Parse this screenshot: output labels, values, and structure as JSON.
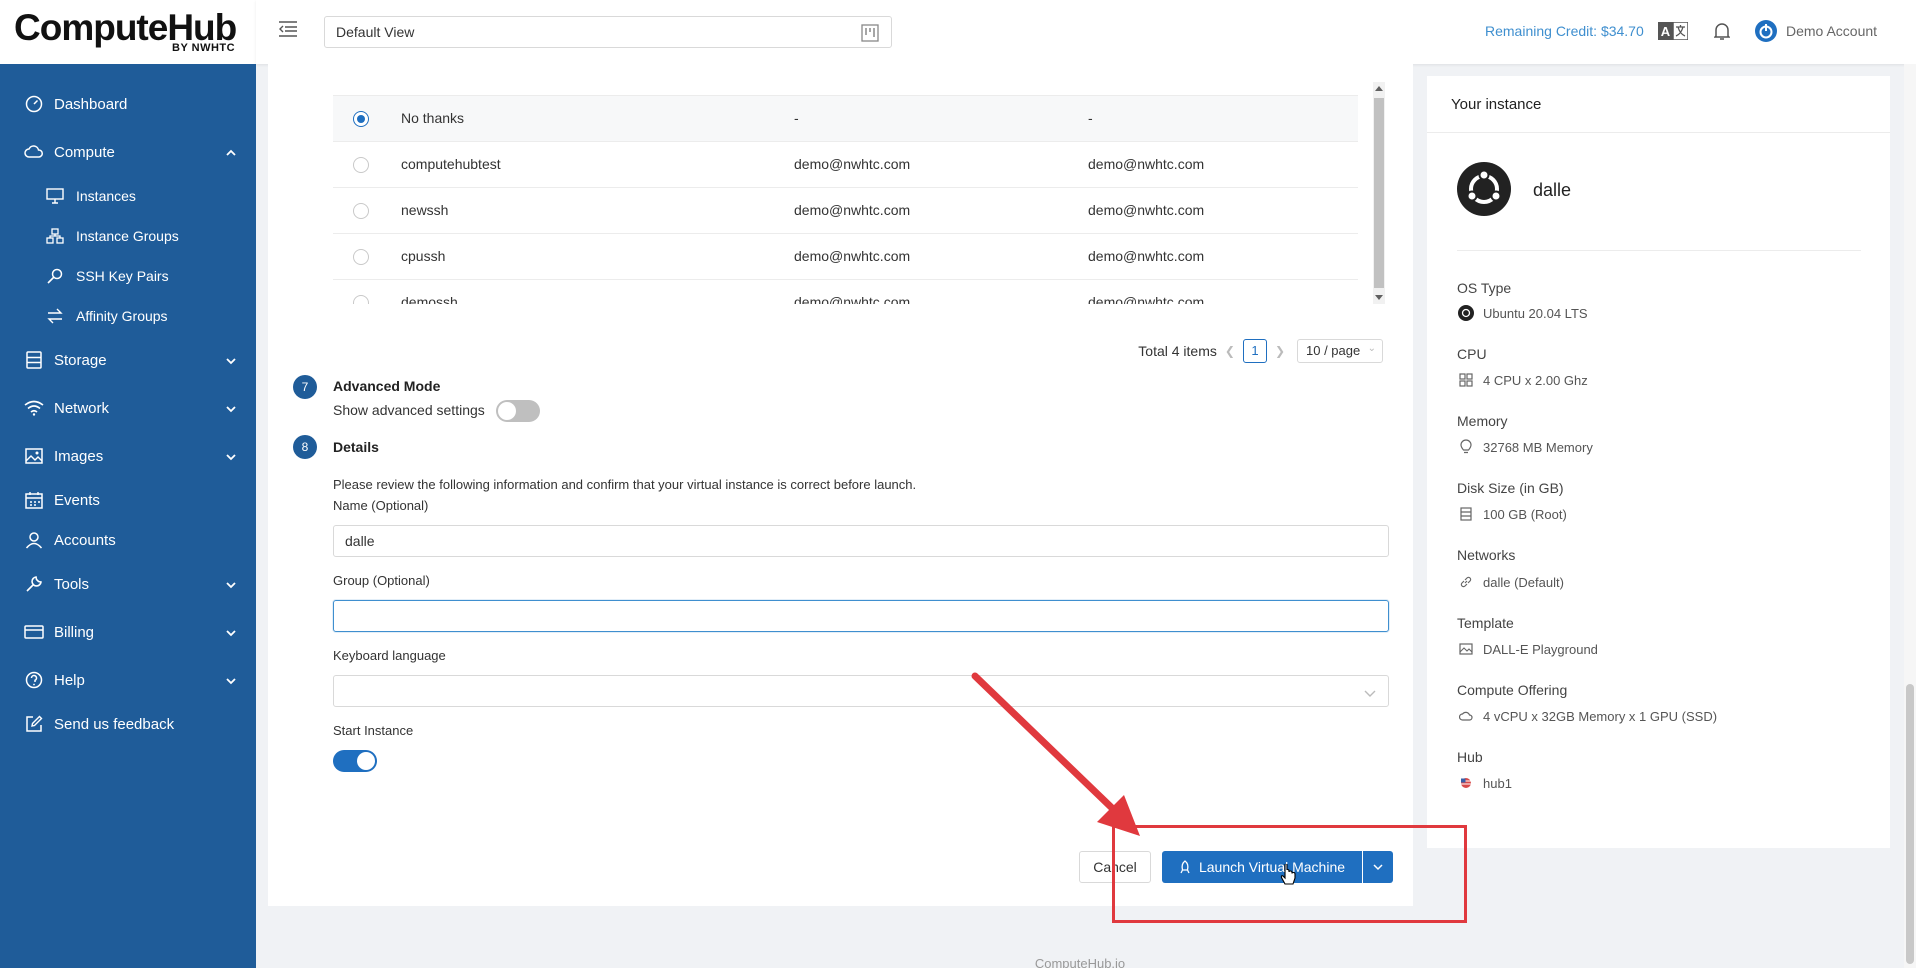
{
  "brand": {
    "name": "ComputeHub",
    "sub": "BY NWHTC"
  },
  "sidebar": {
    "items": [
      {
        "label": "Dashboard",
        "icon": "dashboard-icon"
      },
      {
        "label": "Compute",
        "icon": "cloud-icon",
        "expanded": true,
        "children": [
          {
            "label": "Instances",
            "icon": "monitor-icon"
          },
          {
            "label": "Instance Groups",
            "icon": "cluster-icon"
          },
          {
            "label": "SSH Key Pairs",
            "icon": "key-icon"
          },
          {
            "label": "Affinity Groups",
            "icon": "swap-icon"
          }
        ]
      },
      {
        "label": "Storage",
        "icon": "database-icon"
      },
      {
        "label": "Network",
        "icon": "wifi-icon"
      },
      {
        "label": "Images",
        "icon": "image-icon"
      },
      {
        "label": "Events",
        "icon": "schedule-icon"
      },
      {
        "label": "Accounts",
        "icon": "user-icon"
      },
      {
        "label": "Tools",
        "icon": "tool-icon"
      },
      {
        "label": "Billing",
        "icon": "billing-icon"
      },
      {
        "label": "Help",
        "icon": "question-icon"
      },
      {
        "label": "Send us feedback",
        "icon": "edit-icon"
      }
    ]
  },
  "topbar": {
    "view": "Default View",
    "credit": "Remaining Credit: $34.70",
    "account": "Demo Account"
  },
  "ssh_table": {
    "rows": [
      {
        "name": "No thanks",
        "col2": "-",
        "col3": "-",
        "selected": true
      },
      {
        "name": "computehubtest",
        "col2": "demo@nwhtc.com",
        "col3": "demo@nwhtc.com",
        "selected": false
      },
      {
        "name": "newssh",
        "col2": "demo@nwhtc.com",
        "col3": "demo@nwhtc.com",
        "selected": false
      },
      {
        "name": "cpussh",
        "col2": "demo@nwhtc.com",
        "col3": "demo@nwhtc.com",
        "selected": false
      },
      {
        "name": "demossh",
        "col2": "demo@nwhtc.com",
        "col3": "demo@nwhtc.com",
        "selected": false
      }
    ],
    "total": "Total 4 items",
    "page": "1",
    "page_size": "10 / page"
  },
  "steps": {
    "advanced": {
      "num": "7",
      "title": "Advanced Mode",
      "toggle_label": "Show advanced settings",
      "enabled": false
    },
    "details": {
      "num": "8",
      "title": "Details",
      "intro": "Please review the following information and confirm that your virtual instance is correct before launch."
    }
  },
  "form": {
    "name_label": "Name (Optional)",
    "name_value": "dalle",
    "group_label": "Group (Optional)",
    "group_value": "",
    "keyboard_label": "Keyboard language",
    "keyboard_value": "",
    "start_label": "Start Instance",
    "start_enabled": true
  },
  "actions": {
    "cancel": "Cancel",
    "launch": "Launch Virtual Machine"
  },
  "instance": {
    "title": "Your instance",
    "name": "dalle",
    "specs": [
      {
        "label": "OS Type",
        "value": "Ubuntu 20.04 LTS",
        "icon": "ubuntu-icon"
      },
      {
        "label": "CPU",
        "value": "4 CPU x 2.00 Ghz",
        "icon": "grid-icon"
      },
      {
        "label": "Memory",
        "value": "32768 MB Memory",
        "icon": "bulb-icon"
      },
      {
        "label": "Disk Size (in GB)",
        "value": "100 GB (Root)",
        "icon": "disk-icon"
      },
      {
        "label": "Networks",
        "value": "dalle (Default)",
        "icon": "link-icon"
      },
      {
        "label": "Template",
        "value": "DALL-E Playground",
        "icon": "picture-icon"
      },
      {
        "label": "Compute Offering",
        "value": "4 vCPU x 32GB Memory x 1 GPU (SSD)",
        "icon": "cloud-icon"
      },
      {
        "label": "Hub",
        "value": "hub1",
        "icon": "flag-us-icon"
      }
    ]
  },
  "footer": "ComputeHub.io",
  "colors": {
    "sidebar": "#1f5c99",
    "primary": "#1f6fc0",
    "annotation": "#e0393e"
  }
}
